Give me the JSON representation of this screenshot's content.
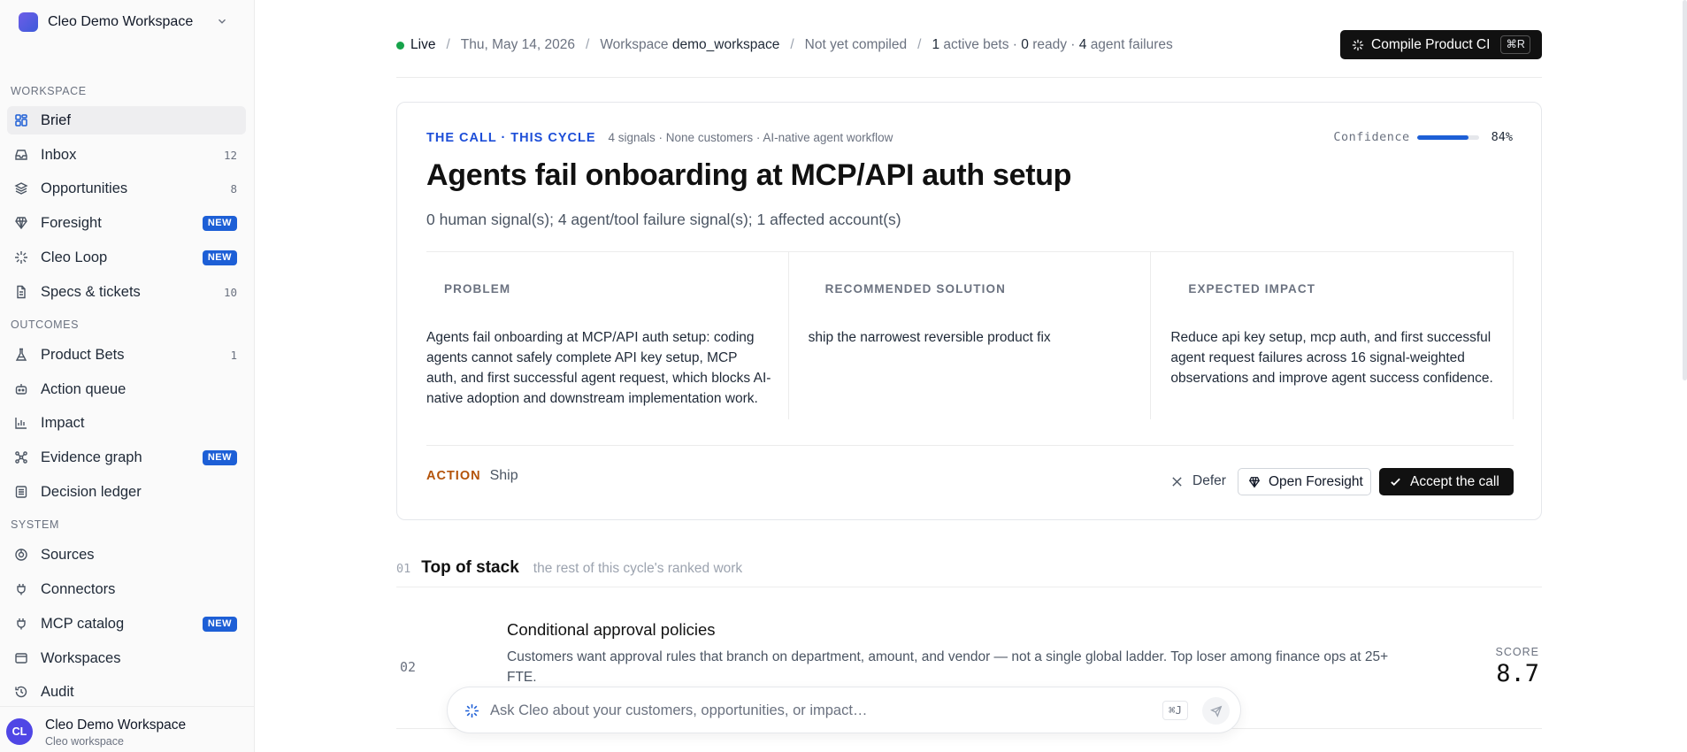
{
  "workspace": {
    "name": "Cleo Demo Workspace"
  },
  "sidebar": {
    "sections": [
      {
        "label": "WORKSPACE",
        "items": [
          {
            "label": "Brief",
            "icon": "grid-icon"
          },
          {
            "label": "Inbox",
            "icon": "inbox-icon",
            "count": "12"
          },
          {
            "label": "Opportunities",
            "icon": "layers-icon",
            "count": "8"
          },
          {
            "label": "Foresight",
            "icon": "gem-icon",
            "badge": "NEW"
          },
          {
            "label": "Cleo Loop",
            "icon": "sparkle-icon",
            "badge": "NEW"
          },
          {
            "label": "Specs & tickets",
            "icon": "document-icon",
            "count": "10"
          }
        ]
      },
      {
        "label": "OUTCOMES",
        "items": [
          {
            "label": "Product Bets",
            "icon": "flask-icon",
            "count": "1"
          },
          {
            "label": "Action queue",
            "icon": "robot-icon"
          },
          {
            "label": "Impact",
            "icon": "bar-chart-icon"
          },
          {
            "label": "Evidence graph",
            "icon": "graph-icon",
            "badge": "NEW"
          },
          {
            "label": "Decision ledger",
            "icon": "ledger-icon"
          }
        ]
      },
      {
        "label": "SYSTEM",
        "items": [
          {
            "label": "Sources",
            "icon": "source-icon"
          },
          {
            "label": "Connectors",
            "icon": "plug-icon"
          },
          {
            "label": "MCP catalog",
            "icon": "plug-icon",
            "badge": "NEW"
          },
          {
            "label": "Workspaces",
            "icon": "window-icon"
          },
          {
            "label": "Audit",
            "icon": "history-icon"
          }
        ]
      }
    ]
  },
  "user": {
    "initials": "CL",
    "name": "Cleo Demo Workspace",
    "sub": "Cleo workspace"
  },
  "status": {
    "live": "Live",
    "date": "Thu, May 14, 2026",
    "workspace_prefix": "Workspace",
    "workspace_id": "demo_workspace",
    "compile_state": "Not yet compiled",
    "active_bets_n": "1",
    "active_bets_label": "active bets ·",
    "ready_n": "0",
    "ready_label": "ready ·",
    "failures_n": "4",
    "failures_label": "agent failures"
  },
  "compile_button": {
    "label": "Compile Product CI",
    "shortcut": "⌘R"
  },
  "call": {
    "eyebrow": "THE CALL · THIS CYCLE",
    "meta": "4 signals · None customers · AI-native agent workflow",
    "confidence_label": "Confidence",
    "confidence_value": 0.84,
    "confidence_text": "84%",
    "title": "Agents fail onboarding at MCP/API auth setup",
    "subtitle": "0 human signal(s); 4 agent/tool failure signal(s); 1 affected account(s)",
    "columns": [
      {
        "heading": "PROBLEM",
        "body": "Agents fail onboarding at MCP/API auth setup: coding agents cannot safely complete API key setup, MCP auth, and first successful agent request, which blocks AI-native adoption and downstream implementation work."
      },
      {
        "heading": "RECOMMENDED SOLUTION",
        "body": "ship the narrowest reversible product fix"
      },
      {
        "heading": "EXPECTED IMPACT",
        "body": "Reduce api key setup, mcp auth, and first successful agent request failures across 16 signal-weighted observations and improve agent success confidence."
      }
    ],
    "action_label": "ACTION",
    "action_value": "Ship",
    "defer_label": "Defer",
    "foresight_label": "Open Foresight",
    "accept_label": "Accept the call"
  },
  "stack": {
    "number": "01",
    "title": "Top of stack",
    "subtitle": "the rest of this cycle's ranked work",
    "rows": [
      {
        "number": "02",
        "title": "Conditional approval policies",
        "description": "Customers want approval rules that branch on department, amount, and vendor — not a single global ladder. Top loser among finance ops at 25+ FTE.",
        "score_label": "SCORE",
        "score": "8.7"
      }
    ]
  },
  "ask": {
    "placeholder": "Ask Cleo about your customers, opportunities, or impact…",
    "shortcut": "⌘J"
  },
  "colors": {
    "accent": "#1d5fd6",
    "live": "#16a34a",
    "action": "#b45309",
    "brand": "#4f46e5"
  }
}
